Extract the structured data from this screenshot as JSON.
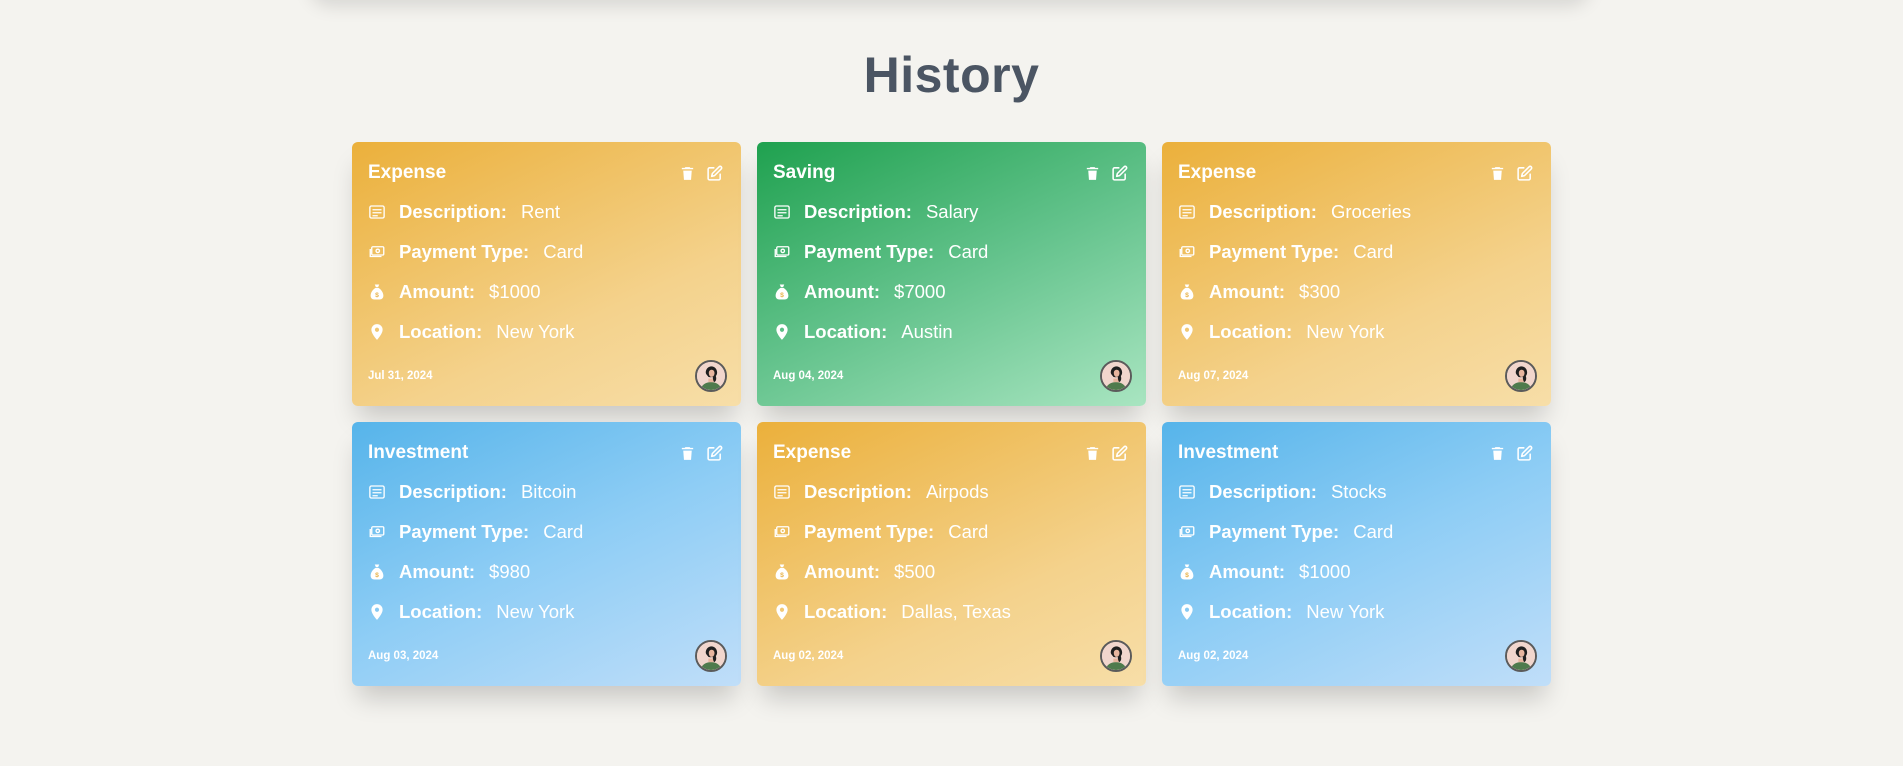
{
  "page": {
    "title": "History"
  },
  "labels": {
    "description": "Description:",
    "payment_type": "Payment Type:",
    "amount": "Amount:",
    "location": "Location:"
  },
  "icons": {
    "delete": "trash-icon",
    "edit": "edit-icon",
    "description": "list-icon",
    "payment_type": "banknote-icon",
    "amount": "money-bag-icon",
    "location": "map-pin-icon",
    "avatar": "user-avatar"
  },
  "colors": {
    "expense": "#ebb03b",
    "saving": "#1fa14f",
    "investment": "#56b4ea",
    "title": "#4b5563",
    "background": "#f4f3ef"
  },
  "cards": [
    {
      "category": "expense",
      "type": "Expense",
      "description": "Rent",
      "payment_type": "Card",
      "amount": "$1000",
      "location": "New York",
      "date": "Jul 31, 2024"
    },
    {
      "category": "saving",
      "type": "Saving",
      "description": "Salary",
      "payment_type": "Card",
      "amount": "$7000",
      "location": "Austin",
      "date": "Aug 04, 2024"
    },
    {
      "category": "expense",
      "type": "Expense",
      "description": "Groceries",
      "payment_type": "Card",
      "amount": "$300",
      "location": "New York",
      "date": "Aug 07, 2024"
    },
    {
      "category": "investment",
      "type": "Investment",
      "description": "Bitcoin",
      "payment_type": "Card",
      "amount": "$980",
      "location": "New York",
      "date": "Aug 03, 2024"
    },
    {
      "category": "expense",
      "type": "Expense",
      "description": "Airpods",
      "payment_type": "Card",
      "amount": "$500",
      "location": "Dallas, Texas",
      "date": "Aug 02, 2024"
    },
    {
      "category": "investment",
      "type": "Investment",
      "description": "Stocks",
      "payment_type": "Card",
      "amount": "$1000",
      "location": "New York",
      "date": "Aug 02, 2024"
    }
  ]
}
